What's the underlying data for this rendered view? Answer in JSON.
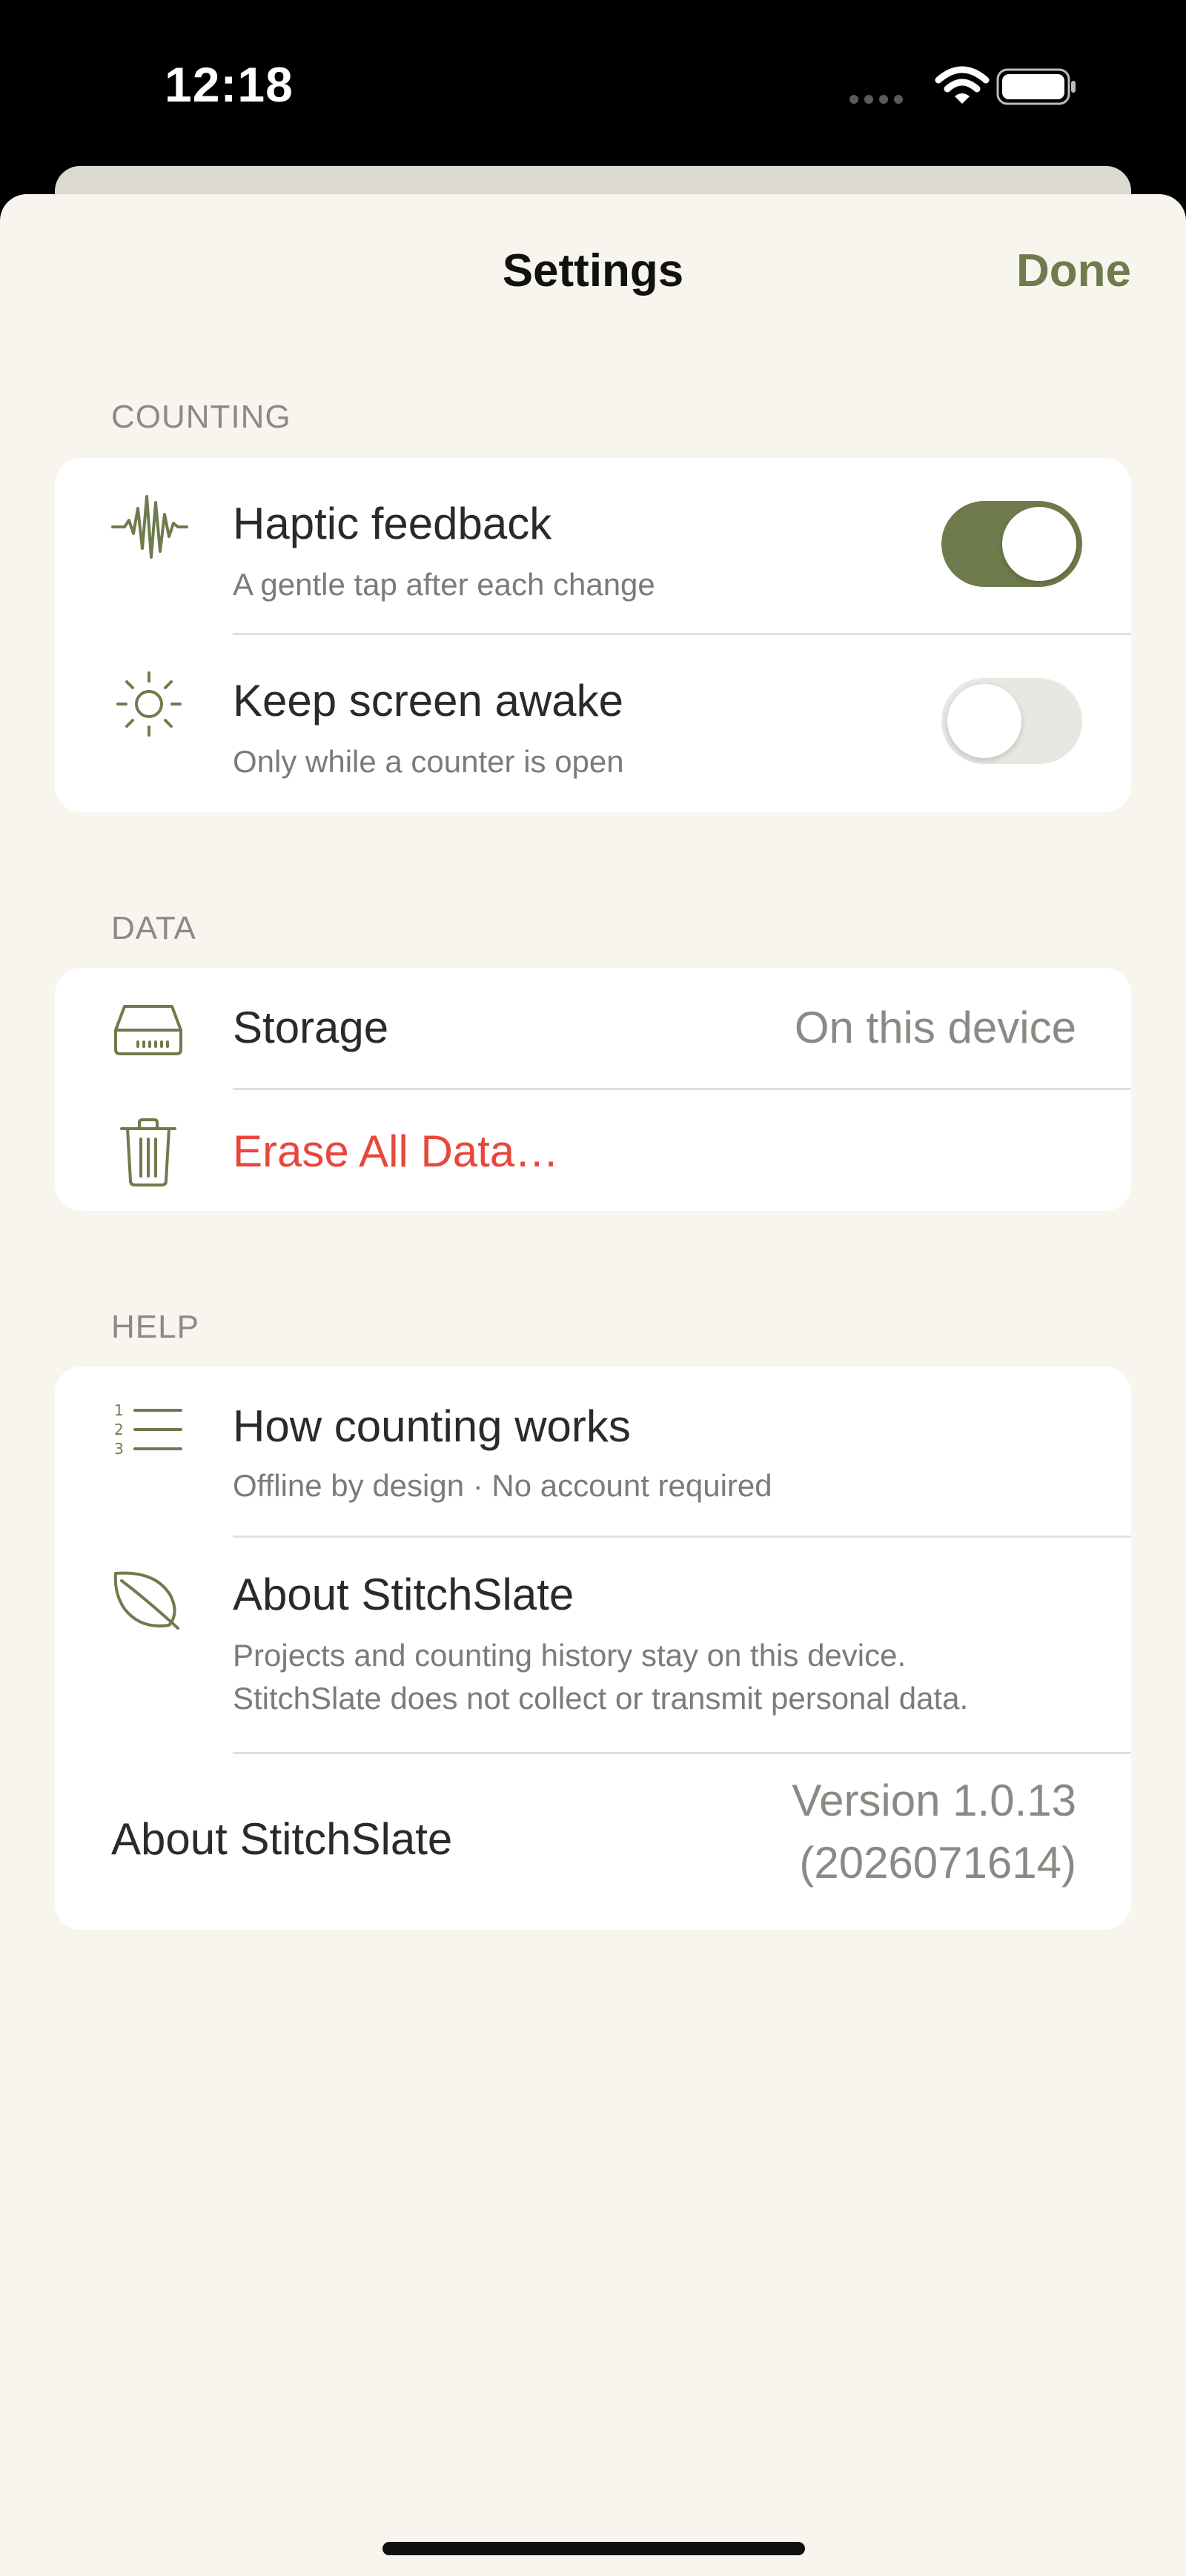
{
  "status_bar": {
    "time": "12:18",
    "icons": [
      "signal-dots-icon",
      "wifi-icon",
      "battery-icon"
    ]
  },
  "nav": {
    "title": "Settings",
    "done_label": "Done"
  },
  "colors": {
    "accent": "#6f7b4c",
    "destructive": "#e8473c",
    "background": "#f8f5ee",
    "card": "#ffffff"
  },
  "sections": {
    "counting": {
      "header": "COUNTING",
      "haptic": {
        "icon": "waveform-icon",
        "title": "Haptic feedback",
        "subtitle": "A gentle tap after each change",
        "enabled": true
      },
      "awake": {
        "icon": "sun-icon",
        "title": "Keep screen awake",
        "subtitle": "Only while a counter is open",
        "enabled": false
      }
    },
    "data": {
      "header": "DATA",
      "storage": {
        "icon": "drive-icon",
        "title": "Storage",
        "value": "On this device"
      },
      "erase": {
        "icon": "trash-icon",
        "title": "Erase All Data…"
      }
    },
    "help": {
      "header": "HELP",
      "how": {
        "icon": "numbered-list-icon",
        "title": "How counting works",
        "subtitle": "Offline by design · No account required"
      },
      "about": {
        "icon": "leaf-icon",
        "title": "About StitchSlate",
        "subtitle_line1": "Projects and counting history stay on this device.",
        "subtitle_line2": "StitchSlate does not collect or transmit personal data."
      },
      "version": {
        "title": "About StitchSlate",
        "value_line1": "Version 1.0.13",
        "value_line2": "(2026071614)"
      }
    }
  }
}
